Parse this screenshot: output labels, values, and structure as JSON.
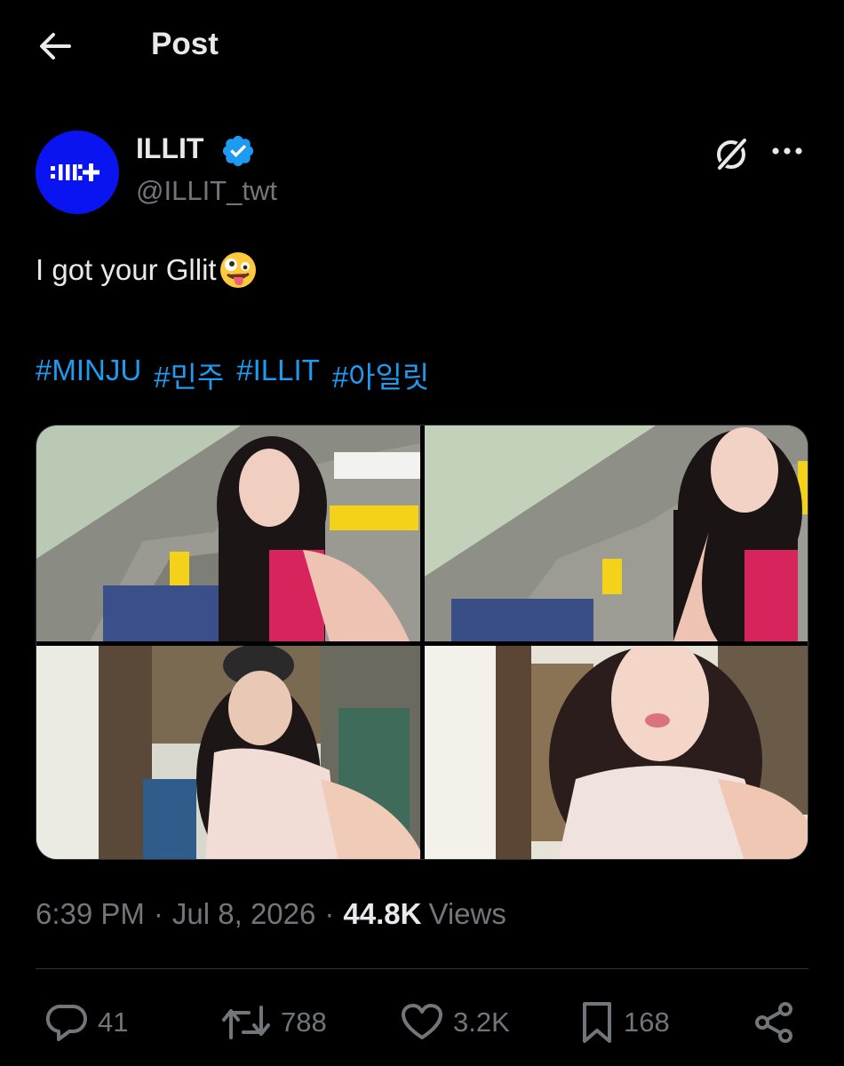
{
  "header": {
    "title": "Post",
    "back_icon": "arrow-left-icon"
  },
  "author": {
    "name": "ILLIT",
    "handle": "@ILLIT_twt",
    "avatar_text": "ILLIT",
    "avatar_color": "#0a14f0",
    "verified": true,
    "verified_color": "#1d9bf0"
  },
  "tweet": {
    "text": "I got your Gllit",
    "emoji": "zany-face-emoji",
    "hashtags": [
      "#MINJU",
      "#민주",
      "#ILLIT",
      "#아일릿"
    ],
    "hashtag_color": "#1d9bf0"
  },
  "media": {
    "count": 4,
    "items": [
      "photo-1",
      "photo-2",
      "photo-3",
      "photo-4"
    ]
  },
  "meta": {
    "time": "6:39 PM",
    "date": "Jul 8, 2026",
    "views_count": "44.8K",
    "views_label": "Views"
  },
  "actions": {
    "replies": "41",
    "reposts": "788",
    "likes": "3.2K",
    "bookmarks": "168"
  },
  "colors": {
    "background": "#000000",
    "text": "#e7e9ea",
    "muted": "#71767b",
    "accent": "#1d9bf0",
    "border": "#2f3336"
  }
}
